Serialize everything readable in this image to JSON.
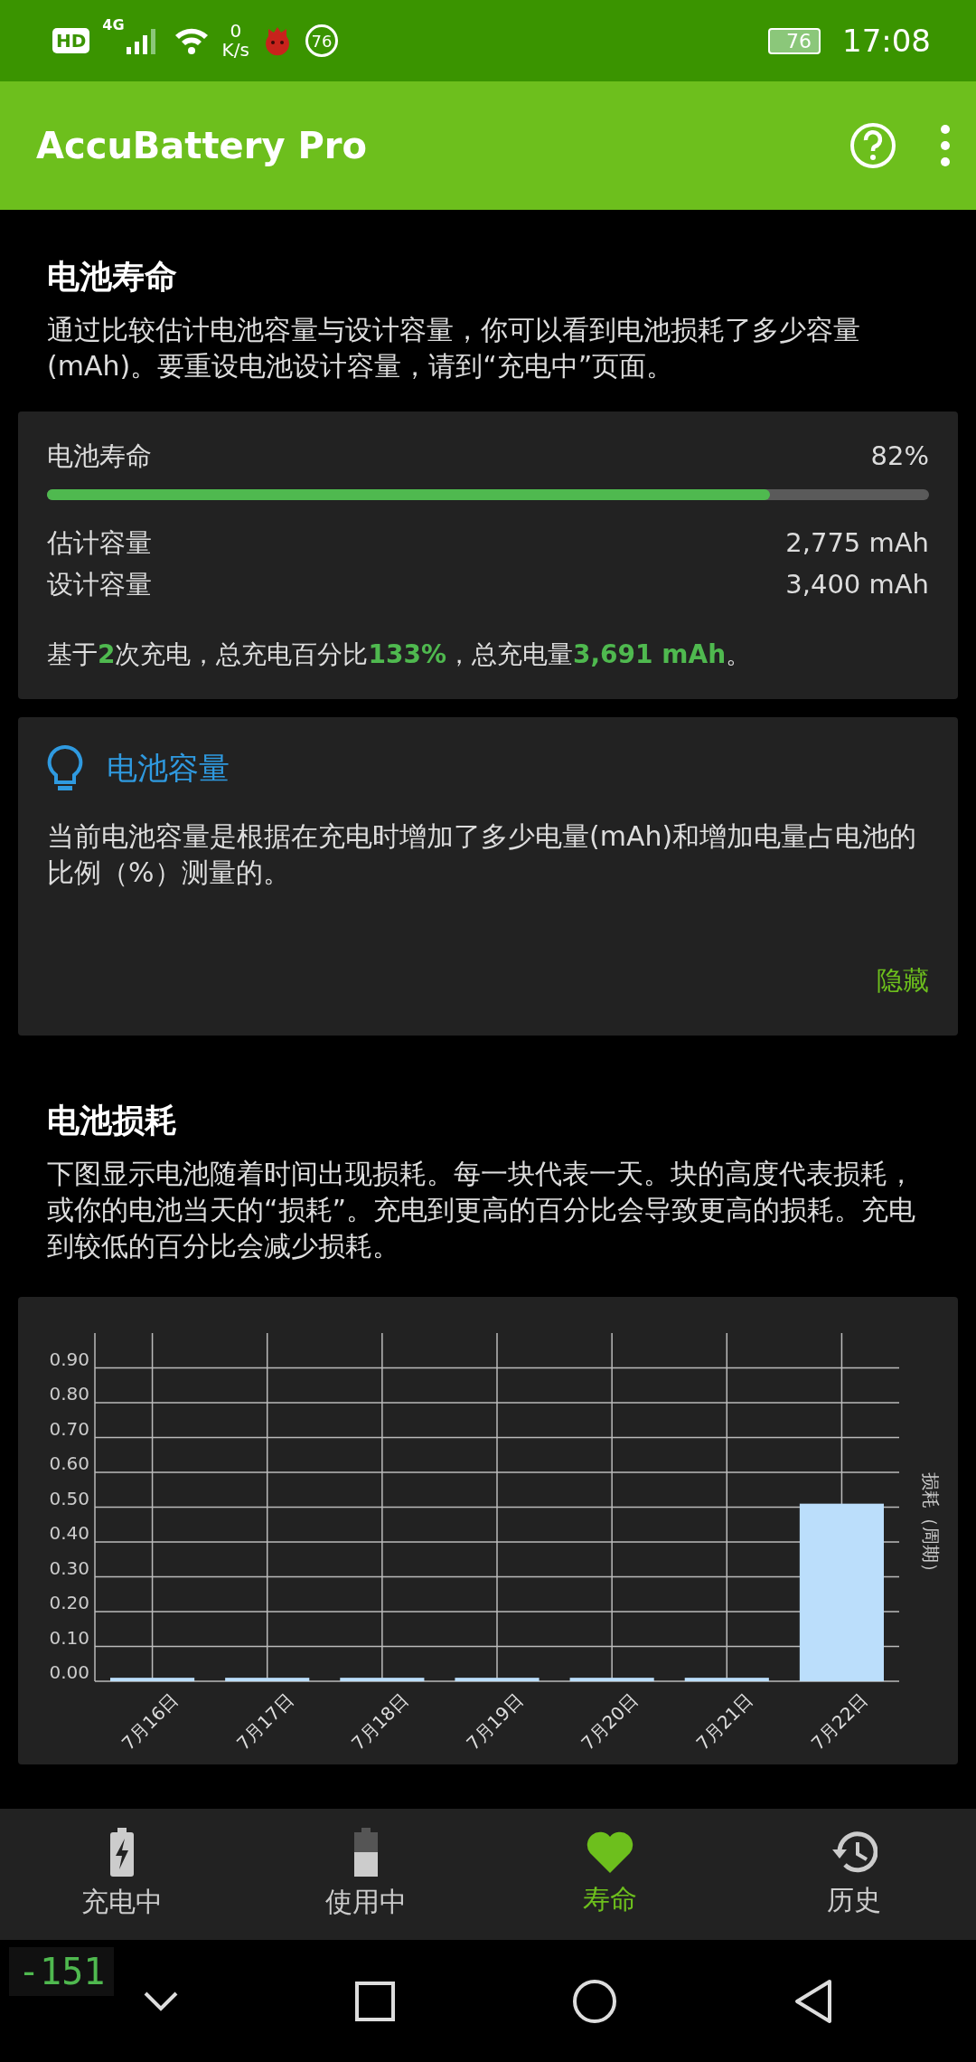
{
  "status_bar": {
    "hd": "HD",
    "network": "4G",
    "speed_value": "0",
    "speed_unit": "K/s",
    "badge": "76",
    "battery": "76",
    "time": "17:08"
  },
  "app_bar": {
    "title": "AccuBattery Pro"
  },
  "intro": {
    "title": "电池寿命",
    "text": "通过比较估计电池容量与设计容量，你可以看到电池损耗了多少容量(mAh)。要重设电池设计容量，请到“充电中”页面。"
  },
  "health_card": {
    "label": "电池寿命",
    "value": "82%",
    "level": 0.82,
    "rows": [
      {
        "label": "估计容量",
        "value": "2,775 mAh"
      },
      {
        "label": "设计容量",
        "value": "3,400 mAh"
      }
    ],
    "summary": "基于**2**次充电，总充电百分比**133%**，总充电量**3,691 mAh**。"
  },
  "tip_card": {
    "title": "电池容量",
    "text": "当前电池容量是根据在充电时增加了多少电量(mAh)和增加电量占电池的比例（%）测量的。",
    "action": "隐藏"
  },
  "wear": {
    "title": "电池损耗",
    "text": "下图显示电池随着时间出现损耗。每一块代表一天。块的高度代表损耗，或你的电池当天的“损耗”。充电到更高的百分比会导致更高的损耗。充电到较低的百分比会减少损耗。",
    "chart_data": {
      "type": "bar",
      "grid": true,
      "ylabel": "损耗（周期）",
      "categories": [
        "7月16日",
        "7月17日",
        "7月18日",
        "7月19日",
        "7月20日",
        "7月21日",
        "7月22日"
      ],
      "values": [
        0.01,
        0.01,
        0.01,
        0.01,
        0.01,
        0.01,
        0.51
      ],
      "ylim": [
        0,
        1
      ],
      "yticks": [
        {
          "value": 0,
          "label": "0.00"
        },
        {
          "value": 0.1,
          "label": "0.10"
        },
        {
          "value": 0.2,
          "label": "0.20"
        },
        {
          "value": 0.3,
          "label": "0.30"
        },
        {
          "value": 0.4,
          "label": "0.40"
        },
        {
          "value": 0.5,
          "label": "0.50"
        },
        {
          "value": 0.6,
          "label": "0.60"
        },
        {
          "value": 0.7,
          "label": "0.70"
        },
        {
          "value": 0.8,
          "label": "0.80"
        },
        {
          "value": 0.9,
          "label": "0.90"
        }
      ]
    }
  },
  "bottom_nav": [
    {
      "kind": "charging",
      "label": "充电中",
      "selected": false
    },
    {
      "kind": "discharging",
      "label": "使用中",
      "selected": false
    },
    {
      "kind": "health",
      "label": "寿命",
      "selected": true
    },
    {
      "kind": "history",
      "label": "历史",
      "selected": false
    }
  ],
  "overlay_counter": "-151"
}
